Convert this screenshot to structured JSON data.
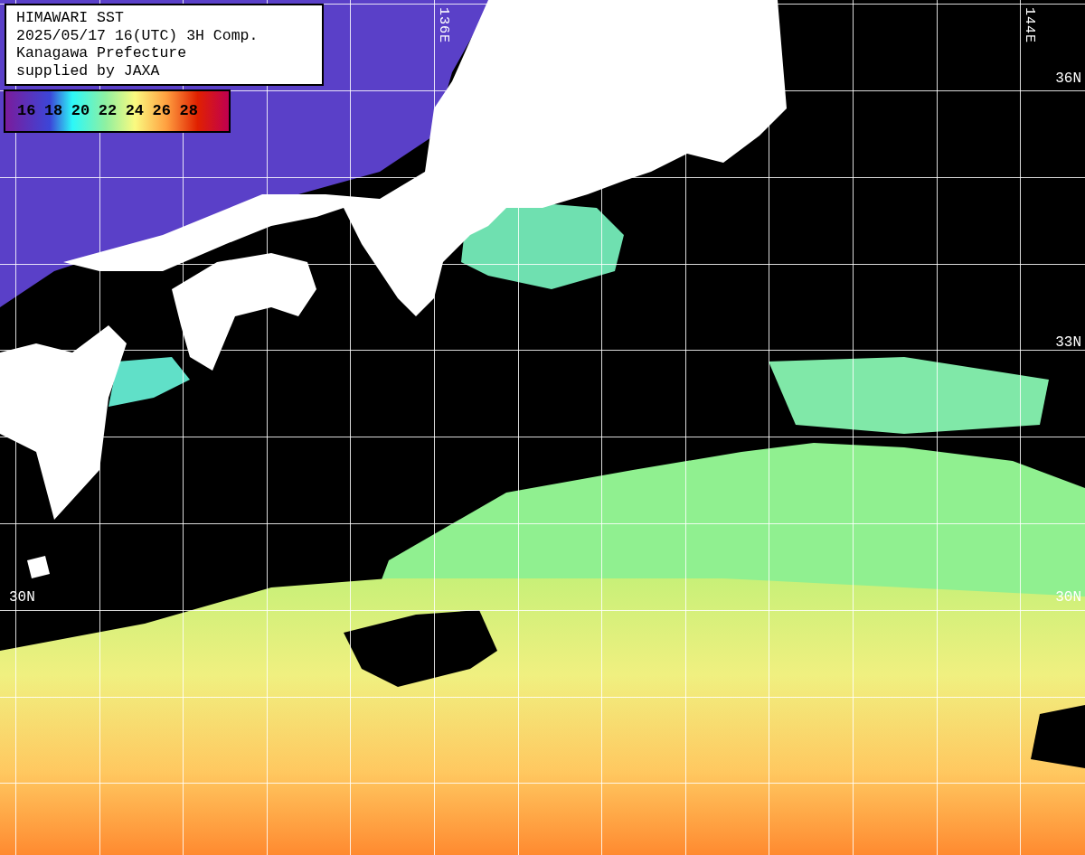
{
  "info_box": {
    "lines": [
      "HIMAWARI SST",
      "2025/05/17 16(UTC) 3H Comp.",
      "Kanagawa Prefecture",
      "supplied by JAXA"
    ]
  },
  "legend": {
    "labels": [
      "16",
      "18",
      "20",
      "22",
      "24",
      "26",
      "28"
    ]
  },
  "map": {
    "longitude_labels": [
      "136E",
      "144E"
    ],
    "latitude_labels": [
      "36N",
      "33N",
      "30N",
      "30N"
    ]
  }
}
